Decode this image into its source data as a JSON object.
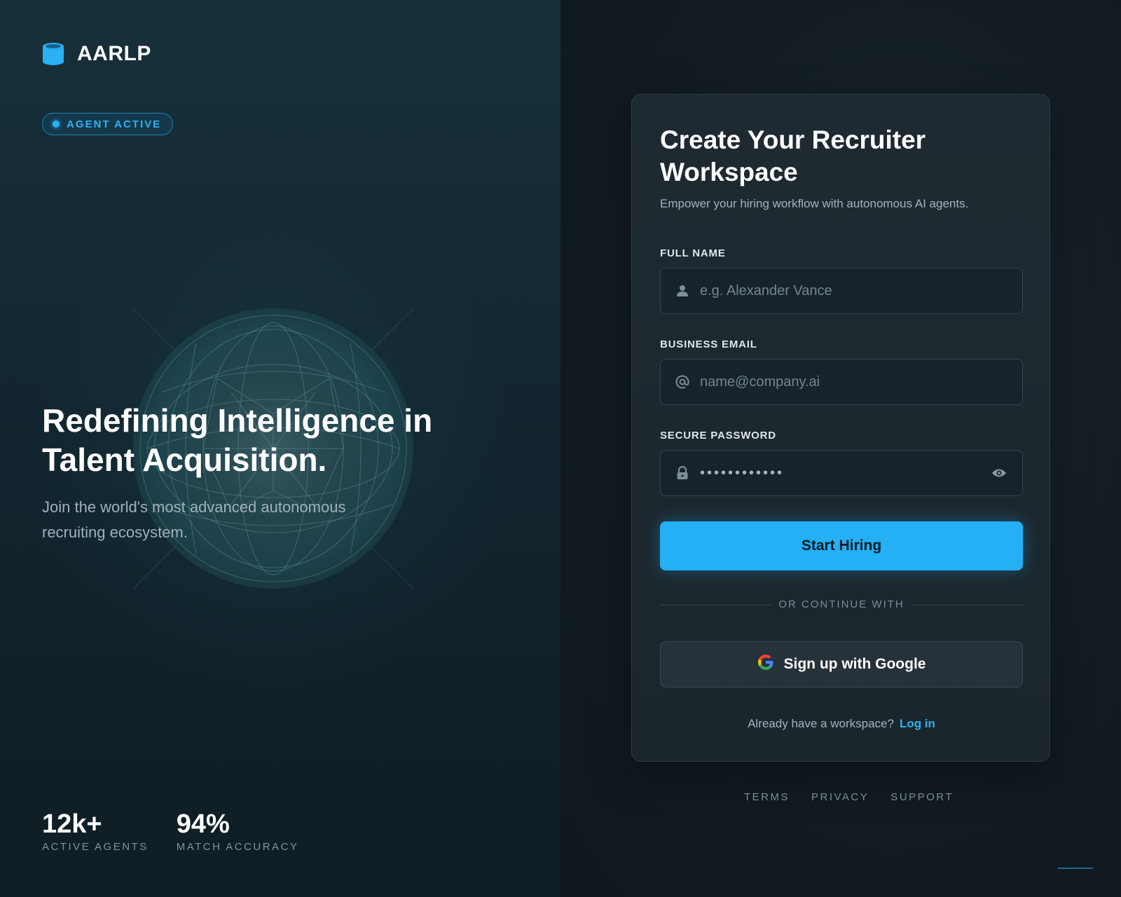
{
  "brand": {
    "name": "AARLP",
    "icon": "database-icon",
    "accent": "#29b0f5"
  },
  "status_badge": {
    "label": "AGENT ACTIVE"
  },
  "hero": {
    "title": "Redefining Intelligence in Talent Acquisition.",
    "subtitle": "Join the world's most advanced autonomous recruiting ecosystem."
  },
  "stats": [
    {
      "value": "12k+",
      "label": "ACTIVE AGENTS"
    },
    {
      "value": "94%",
      "label": "MATCH ACCURACY"
    }
  ],
  "form": {
    "title": "Create Your Recruiter Workspace",
    "subtitle": "Empower your hiring workflow with autonomous AI agents.",
    "full_name": {
      "label": "FULL NAME",
      "placeholder": "e.g. Alexander Vance",
      "icon": "user-icon"
    },
    "email": {
      "label": "BUSINESS EMAIL",
      "placeholder": "name@company.ai",
      "icon": "at-icon"
    },
    "password": {
      "label": "SECURE PASSWORD",
      "masked_value": "••••••••••••",
      "icon": "lock-icon",
      "toggle_icon": "eye-icon"
    },
    "submit_label": "Start Hiring",
    "divider_label": "OR CONTINUE WITH",
    "google_label": "Sign up with Google",
    "login_prompt": "Already have a workspace?",
    "login_link": "Log in"
  },
  "footer_links": [
    {
      "label": "TERMS"
    },
    {
      "label": "PRIVACY"
    },
    {
      "label": "SUPPORT"
    }
  ],
  "colors": {
    "primary_button": "#23b0f5",
    "link": "#2fb2f2",
    "card_background": "#1e2a31",
    "page_background": "#111c23"
  }
}
